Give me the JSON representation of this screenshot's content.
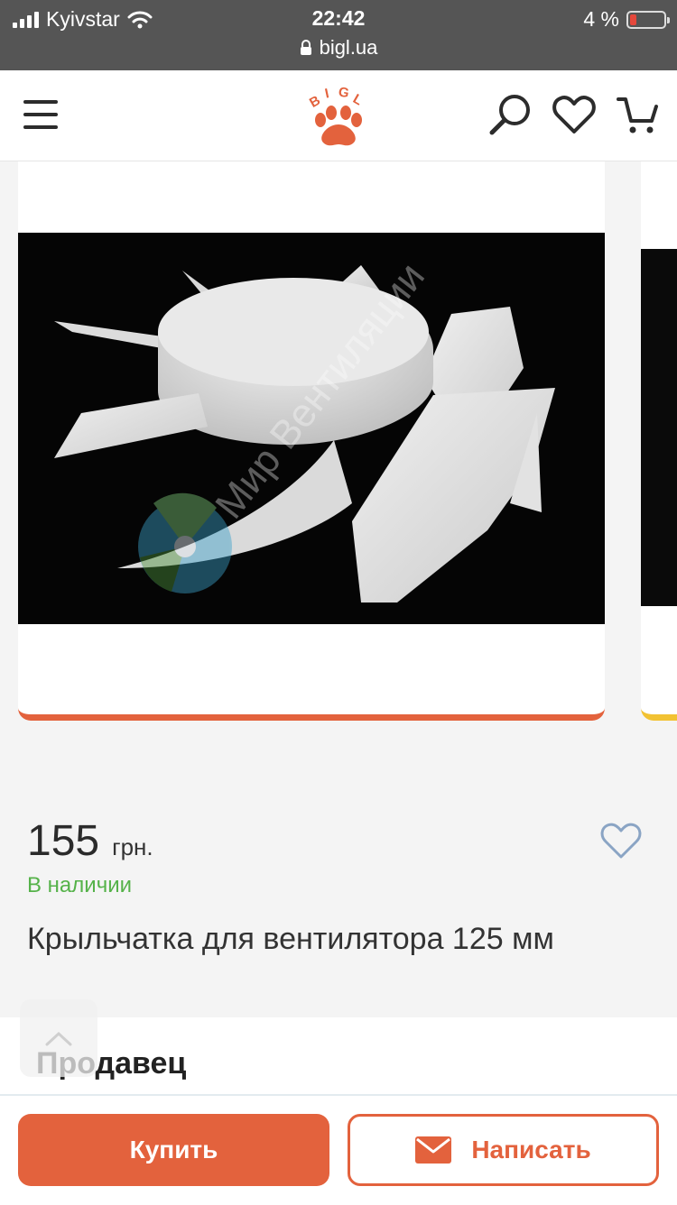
{
  "status_bar": {
    "carrier": "Kyivstar",
    "time": "22:42",
    "battery_text": "4 %",
    "battery_level": 0.04,
    "url": "bigl.ua",
    "icons": [
      "signal-icon",
      "wifi-icon",
      "battery-icon",
      "lock-icon"
    ]
  },
  "header": {
    "logo_text": "BIGL",
    "icons": [
      "menu-icon",
      "search-icon",
      "heart-icon",
      "cart-icon"
    ],
    "brand_color": "#e3623d"
  },
  "gallery": {
    "watermark": "Мир Вентиляции",
    "active_indicator_color": "#e3623d",
    "next_indicator_color": "#f2c233"
  },
  "product": {
    "price": "155",
    "currency": "грн.",
    "stock_status": "В наличии",
    "title": "Крыльчатка для вентилятора 125 мм"
  },
  "seller": {
    "title": "Продавец"
  },
  "actions": {
    "buy_label": "Купить",
    "write_label": "Написать"
  },
  "colors": {
    "accent": "#e3623d",
    "in_stock": "#55b249",
    "favorite_outline": "#8aa4c4"
  }
}
